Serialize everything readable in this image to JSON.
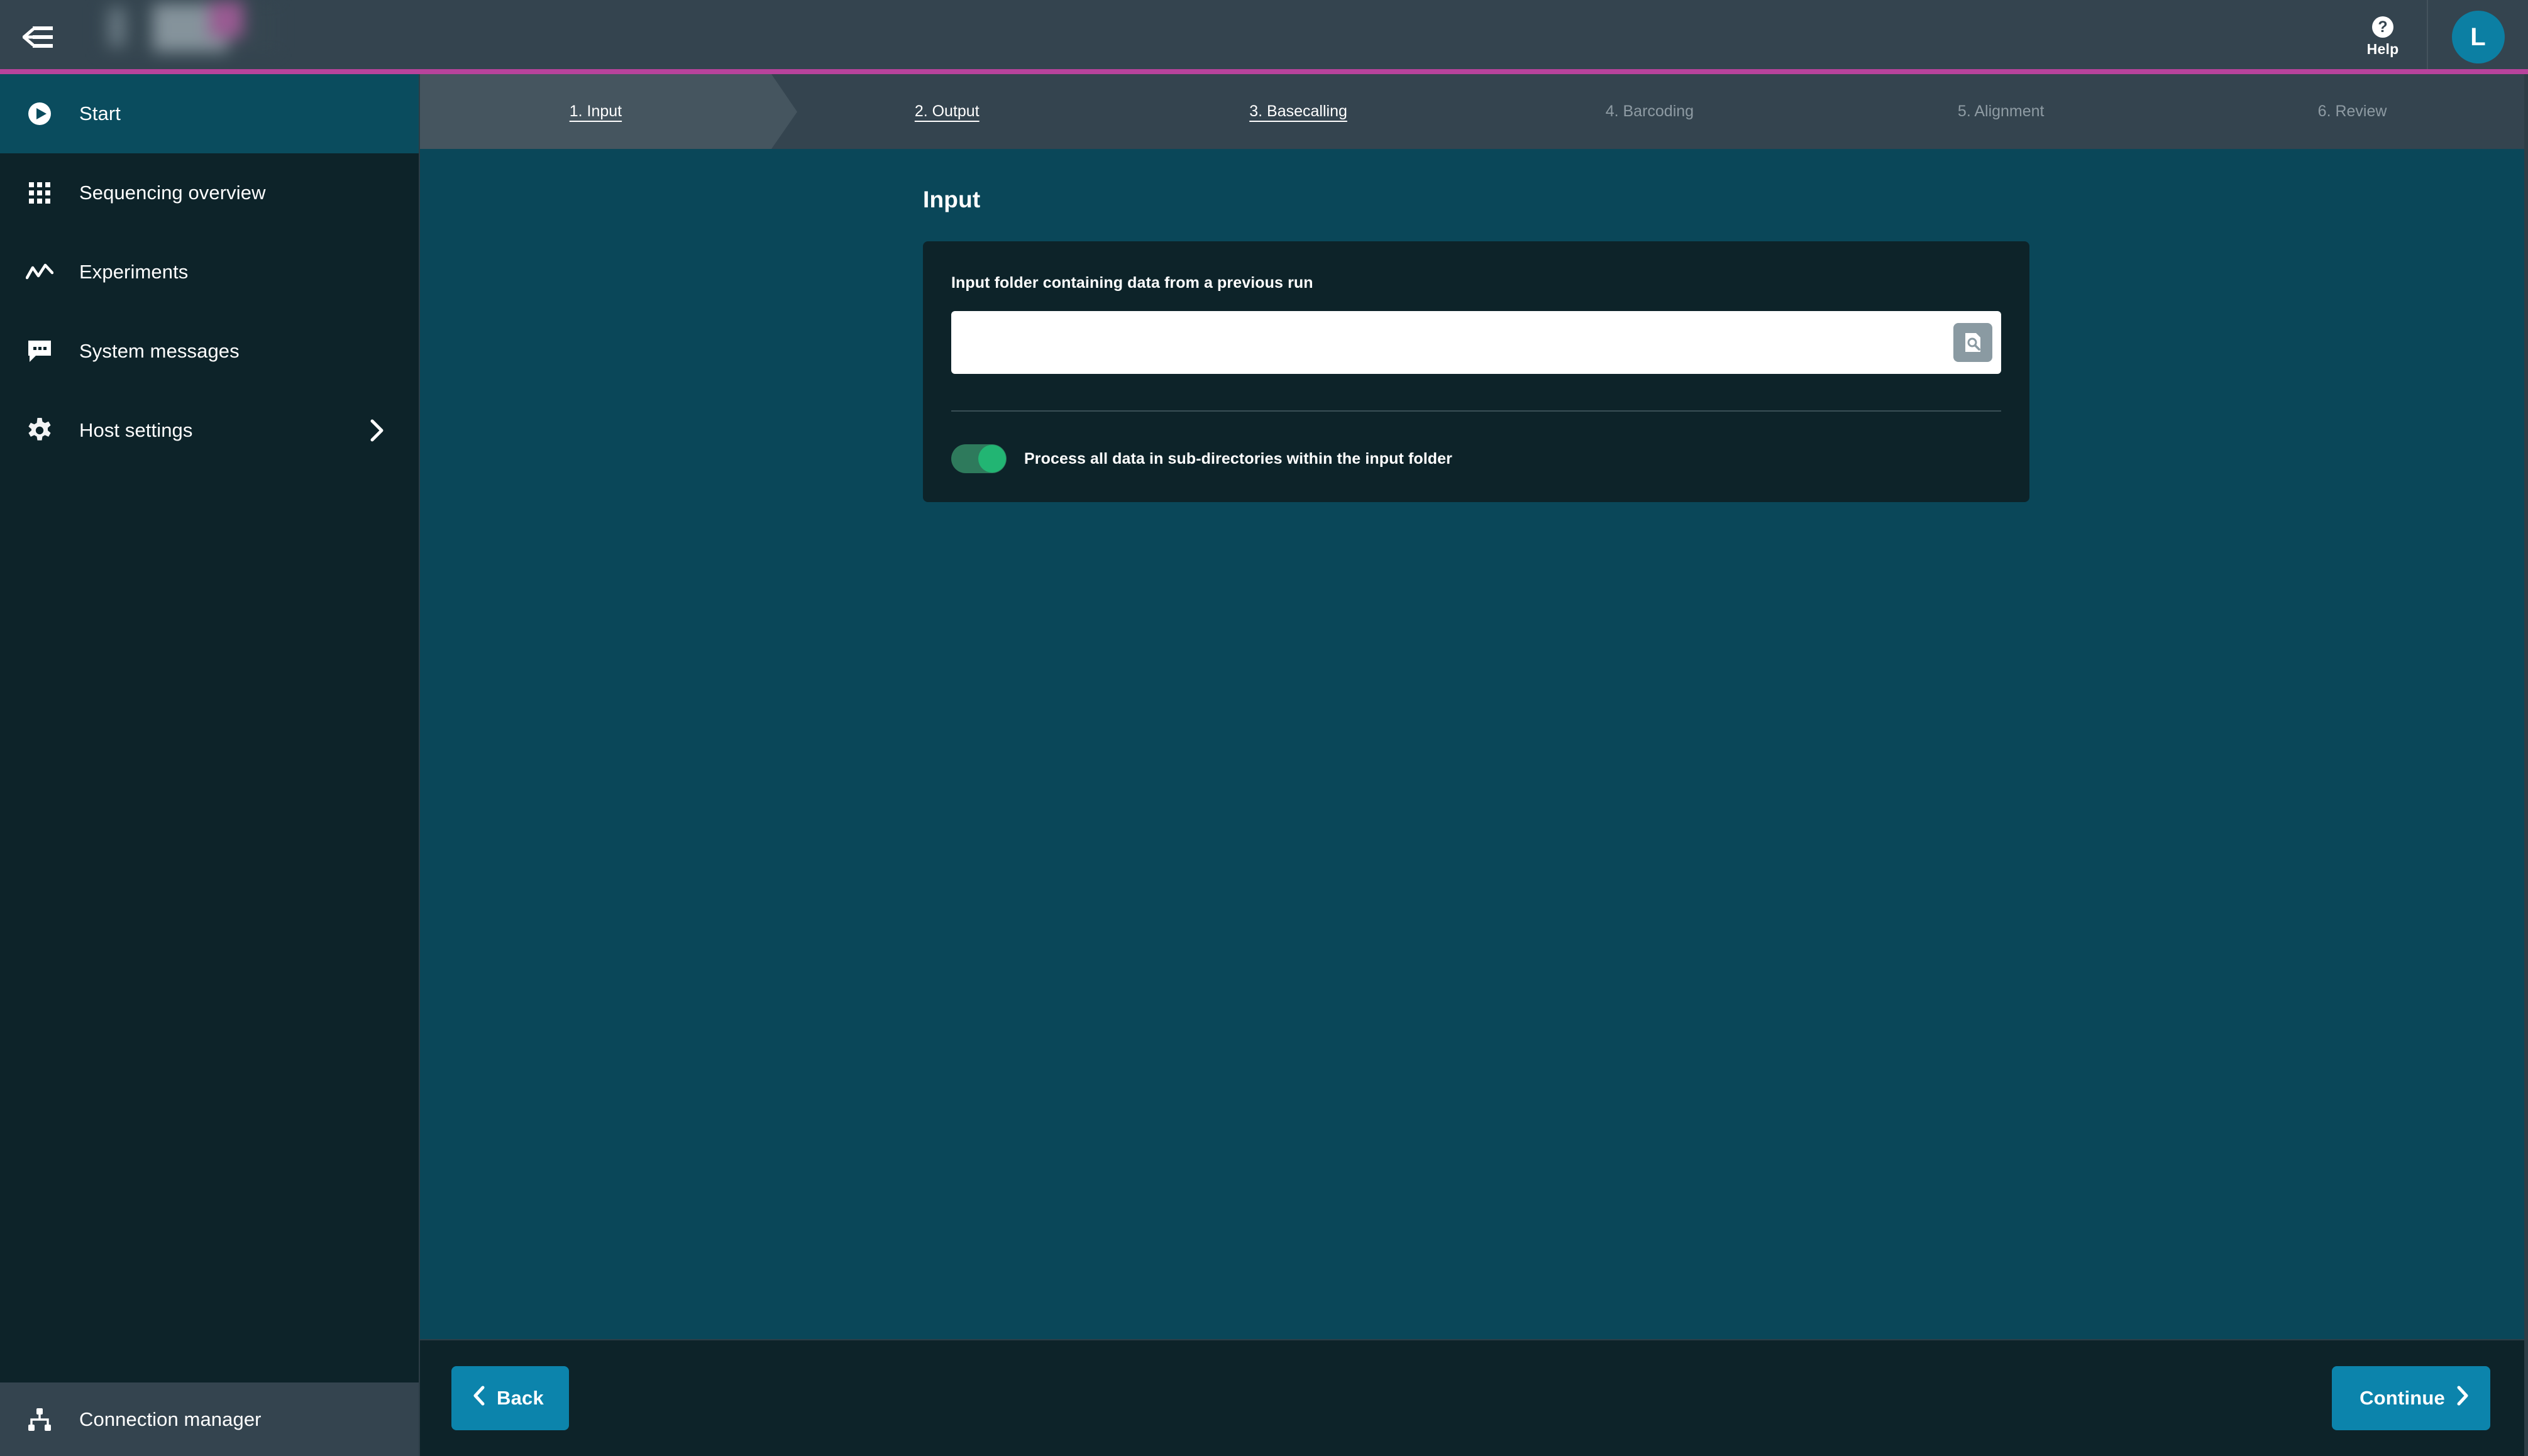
{
  "topbar": {
    "menu_icon": "collapse-sidebar-icon",
    "logo": "redacted-brand-logo",
    "help_glyph": "?",
    "help_label": "Help",
    "avatar_initial": "L"
  },
  "sidebar": {
    "items": [
      {
        "label": "Start",
        "icon": "play-circle-icon",
        "active": true,
        "chevron": false
      },
      {
        "label": "Sequencing overview",
        "icon": "grid-icon",
        "active": false,
        "chevron": false
      },
      {
        "label": "Experiments",
        "icon": "line-chart-icon",
        "active": false,
        "chevron": false
      },
      {
        "label": "System messages",
        "icon": "chat-bubble-icon",
        "active": false,
        "chevron": false
      },
      {
        "label": "Host settings",
        "icon": "gear-icon",
        "active": false,
        "chevron": true
      }
    ],
    "footer": {
      "label": "Connection manager",
      "icon": "sitemap-icon"
    }
  },
  "wizard": {
    "tabs": [
      {
        "label": "1. Input",
        "state": "active"
      },
      {
        "label": "2. Output",
        "state": "enabled"
      },
      {
        "label": "3. Basecalling",
        "state": "enabled"
      },
      {
        "label": "4. Barcoding",
        "state": "disabled"
      },
      {
        "label": "5. Alignment",
        "state": "disabled"
      },
      {
        "label": "6. Review",
        "state": "disabled"
      }
    ]
  },
  "main": {
    "page_title": "Input",
    "card": {
      "field_label": "Input folder containing data from a previous run",
      "input_value": "",
      "input_placeholder": "",
      "browse_icon": "file-search-icon",
      "toggle": {
        "label": "Process all data in sub-directories within the input folder",
        "state": "on"
      }
    }
  },
  "footer": {
    "back_label": "Back",
    "back_icon": "chevron-left-icon",
    "continue_label": "Continue",
    "continue_icon": "chevron-right-icon"
  },
  "colors": {
    "accent_magenta": "#b8439c",
    "accent_blue": "#0c84ac",
    "main_bg": "#0a4759",
    "panel_bg": "#0d2329",
    "header_bg": "#34444f",
    "toggle_on": "#22b573"
  }
}
